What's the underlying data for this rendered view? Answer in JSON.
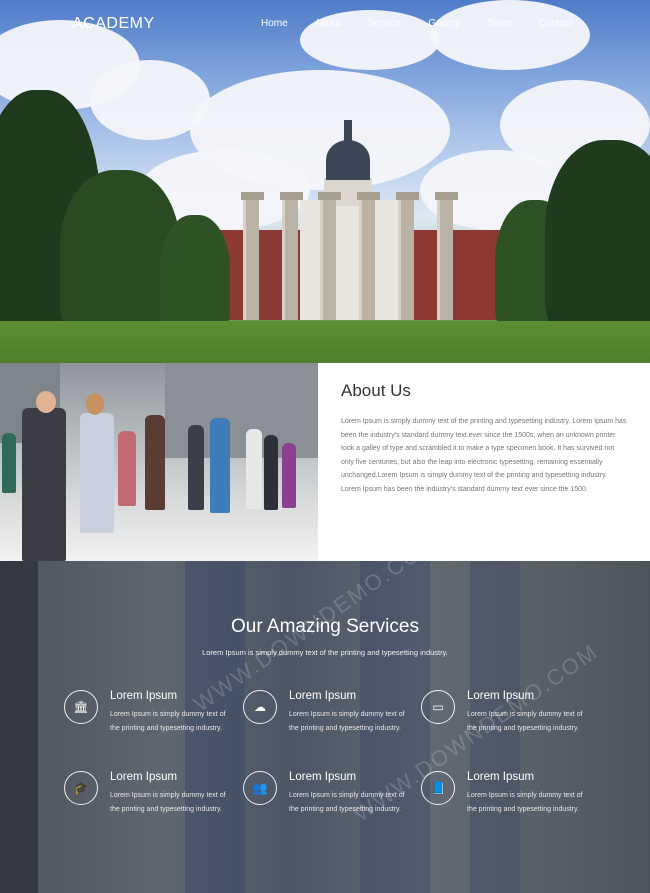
{
  "nav": {
    "logo": "ACADEMY",
    "items": [
      "Home",
      "About",
      "Service",
      "Gallery",
      "Team",
      "Contact"
    ]
  },
  "about": {
    "title": "About Us",
    "text": "Lorem Ipsum is simply dummy text of the printing and typesetting industry. Lorem Ipsum has been the industry's standard dummy text ever since the 1500s, when an unknown printer took a galley of type and scrambled it to make a type specimen book. It has survived not only five centuries, but also the leap into electronic typesetting, remaining essentially unchanged.Lorem Ipsum is simply dummy text of the printing and typesetting industry. Lorem Ipsum has been the industry's standard dummy text ever since the 1500."
  },
  "services": {
    "title": "Our Amazing Services",
    "subtitle": "Lorem Ipsum is simply dummy text of the printing and typesetting industry.",
    "items": [
      {
        "icon": "bank-icon",
        "glyph": "🏛",
        "title": "Lorem Ipsum",
        "desc": "Lorem Ipsum is simply dummy text of the printing and typesetting industry."
      },
      {
        "icon": "cloud-icon",
        "glyph": "☁",
        "title": "Lorem Ipsum",
        "desc": "Lorem Ipsum is simply dummy text of the printing and typesetting industry."
      },
      {
        "icon": "monitor-icon",
        "glyph": "▭",
        "title": "Lorem Ipsum",
        "desc": "Lorem Ipsum is simply dummy text of the printing and typesetting industry."
      },
      {
        "icon": "graduation-cap-icon",
        "glyph": "🎓",
        "title": "Lorem Ipsum",
        "desc": "Lorem Ipsum is simply dummy text of the printing and typesetting industry."
      },
      {
        "icon": "users-icon",
        "glyph": "👥",
        "title": "Lorem Ipsum",
        "desc": "Lorem Ipsum is simply dummy text of the printing and typesetting industry."
      },
      {
        "icon": "book-icon",
        "glyph": "📘",
        "title": "Lorem Ipsum",
        "desc": "Lorem Ipsum is simply dummy text of the printing and typesetting industry."
      }
    ]
  },
  "watermark": "WWW.DOWNDEMO.COM"
}
